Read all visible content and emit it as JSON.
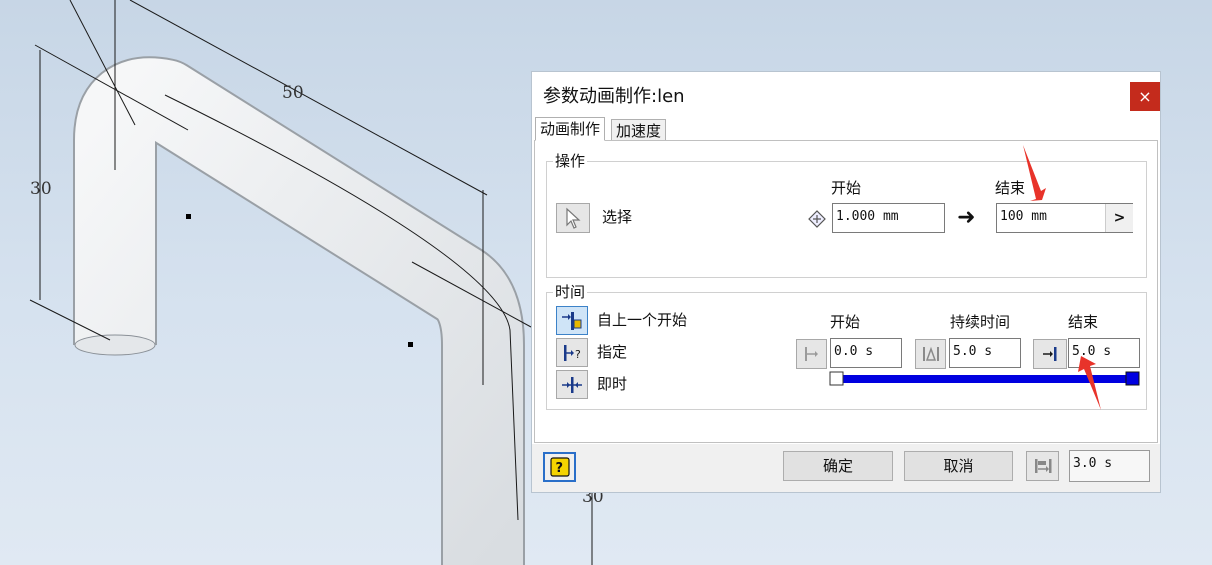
{
  "viewport": {
    "dim_top": "50",
    "dim_left": "30",
    "dim_bottom": "30"
  },
  "dialog": {
    "title": "参数动画制作:len",
    "close_glyph": "×",
    "tabs": [
      {
        "label": "动画制作",
        "active": true
      },
      {
        "label": "加速度",
        "active": false
      }
    ],
    "operation": {
      "group_label": "操作",
      "select_label": "选择",
      "start_label": "开始",
      "end_label": "结束",
      "start_value": "1.000 mm",
      "end_value": "100 mm",
      "arrow_glyph": "➜",
      "expand_glyph": ">"
    },
    "time": {
      "group_label": "时间",
      "options": [
        {
          "label": "自上一个开始",
          "selected": true
        },
        {
          "label": "指定",
          "selected": false
        },
        {
          "label": "即时",
          "selected": false
        }
      ],
      "start_label": "开始",
      "duration_label": "持续时间",
      "end_label": "结束",
      "start_value": "0.0 s",
      "duration_value": "5.0 s",
      "end_value": "5.0 s",
      "timeline": {
        "start": 0.0,
        "end": 5.0
      }
    },
    "footer": {
      "ok_label": "确定",
      "cancel_label": "取消",
      "time_value": "3.0 s"
    }
  },
  "colors": {
    "close_button": "#c42b1c",
    "timeline_bar": "#0000e0",
    "annotation_arrow": "#e8332a",
    "accent": "#3c82c8"
  }
}
